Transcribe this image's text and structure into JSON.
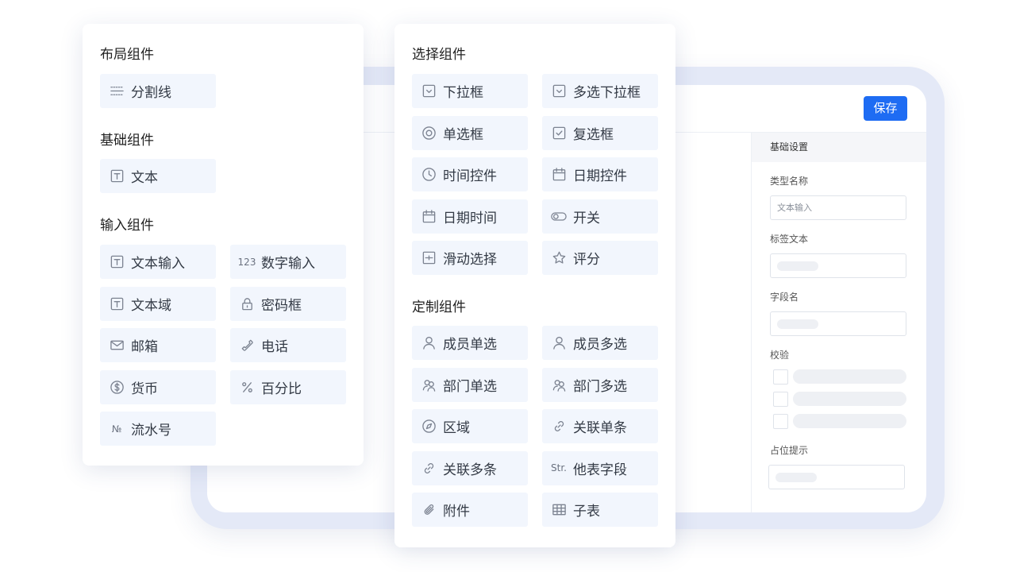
{
  "designer": {
    "save_label": "保存",
    "settings": {
      "header": "基础设置",
      "type_name_label": "类型名称",
      "type_name_value": "文本输入",
      "tag_text_label": "标签文本",
      "field_name_label": "字段名",
      "validation_label": "校验",
      "placeholder_label": "占位提示"
    }
  },
  "left_panel": {
    "layout_title": "布局组件",
    "layout_items": [
      {
        "label": "分割线",
        "icon": "divider-icon"
      }
    ],
    "basic_title": "基础组件",
    "basic_items": [
      {
        "label": "文本",
        "icon": "text-icon"
      }
    ],
    "input_title": "输入组件",
    "input_items": [
      {
        "label": "文本输入",
        "icon": "text-icon"
      },
      {
        "label": "数字输入",
        "icon": "number-icon",
        "icon_text": "123"
      },
      {
        "label": "文本域",
        "icon": "text-icon"
      },
      {
        "label": "密码框",
        "icon": "lock-icon"
      },
      {
        "label": "邮箱",
        "icon": "mail-icon"
      },
      {
        "label": "电话",
        "icon": "phone-icon"
      },
      {
        "label": "货币",
        "icon": "dollar-icon"
      },
      {
        "label": "百分比",
        "icon": "percent-icon"
      },
      {
        "label": "流水号",
        "icon": "serial-number-icon",
        "icon_text": "№"
      }
    ]
  },
  "mid_panel": {
    "select_title": "选择组件",
    "select_items": [
      {
        "label": "下拉框",
        "icon": "dropdown-icon"
      },
      {
        "label": "多选下拉框",
        "icon": "dropdown-icon"
      },
      {
        "label": "单选框",
        "icon": "radio-icon"
      },
      {
        "label": "复选框",
        "icon": "checkbox-icon"
      },
      {
        "label": "时间控件",
        "icon": "clock-icon"
      },
      {
        "label": "日期控件",
        "icon": "calendar-icon"
      },
      {
        "label": "日期时间",
        "icon": "calendar-icon"
      },
      {
        "label": "开关",
        "icon": "toggle-icon"
      },
      {
        "label": "滑动选择",
        "icon": "slider-icon"
      },
      {
        "label": "评分",
        "icon": "star-icon"
      }
    ],
    "custom_title": "定制组件",
    "custom_items": [
      {
        "label": "成员单选",
        "icon": "user-icon"
      },
      {
        "label": "成员多选",
        "icon": "user-icon"
      },
      {
        "label": "部门单选",
        "icon": "department-icon"
      },
      {
        "label": "部门多选",
        "icon": "department-icon"
      },
      {
        "label": "区域",
        "icon": "compass-icon"
      },
      {
        "label": "关联单条",
        "icon": "link-icon"
      },
      {
        "label": "关联多条",
        "icon": "link-icon"
      },
      {
        "label": "他表字段",
        "icon": "other-table-field-icon",
        "icon_text": "Str."
      },
      {
        "label": "附件",
        "icon": "paperclip-icon"
      },
      {
        "label": "子表",
        "icon": "table-icon"
      }
    ]
  },
  "colors": {
    "accent": "#1e6cf3",
    "item_background": "#f2f6fd",
    "frame": "#e4e9f7"
  }
}
